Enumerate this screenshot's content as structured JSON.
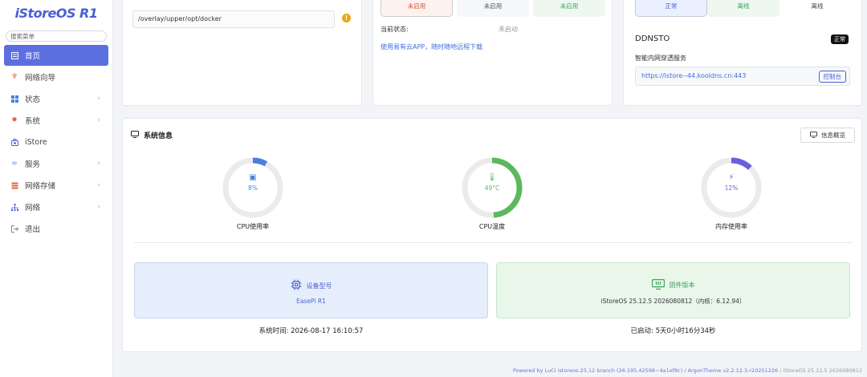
{
  "sidebar": {
    "logo": "iStoreOS R1",
    "search_placeholder": "搜索菜单",
    "items": [
      {
        "label": "首页",
        "icon": "home-icon",
        "active": true
      },
      {
        "label": "网络向导",
        "icon": "wizard-icon"
      },
      {
        "label": "状态",
        "icon": "status-icon",
        "arrow": "›"
      },
      {
        "label": "系统",
        "icon": "system-gear-icon",
        "arrow": "›"
      },
      {
        "label": "iStore",
        "icon": "store-icon"
      },
      {
        "label": "服务",
        "icon": "service-icon",
        "arrow": "›"
      },
      {
        "label": "网络存储",
        "icon": "storage-icon",
        "arrow": "›"
      },
      {
        "label": "网络",
        "icon": "network-icon",
        "arrow": "›"
      },
      {
        "label": "退出",
        "icon": "logout-icon"
      }
    ]
  },
  "docker_card": {
    "path": "/overlay/upper/opt/docker",
    "warn_glyph": "!"
  },
  "remote_card": {
    "segments": [
      "未启用",
      "未启用",
      "未启用"
    ],
    "status_label": "当前状态:",
    "status_value": "未启动",
    "link": "使用易有云APP，随时随地远程下载"
  },
  "ddnsto_card": {
    "segments": [
      "正常",
      "离线",
      "离线"
    ],
    "title": "DDNSTO",
    "badge": "正常",
    "subtitle": "智能内网穿透服务",
    "url": "https://istore--44.kooldns.cn:443",
    "console_btn": "控制台"
  },
  "system_info": {
    "title": "系统信息",
    "overview_btn": "信息概览",
    "gauges": [
      {
        "label": "CPU使用率",
        "value": "8%",
        "percent": 8,
        "color": "#4a7fe0",
        "icon": "cpu-icon",
        "glyph": "▣"
      },
      {
        "label": "CPU温度",
        "value": "49°C",
        "percent": 49,
        "color": "#5cb85c",
        "icon": "thermometer-icon",
        "glyph": "🌡"
      },
      {
        "label": "内存使用率",
        "value": "12%",
        "percent": 12,
        "color": "#6b5fe0",
        "icon": "memory-icon",
        "glyph": "⚡"
      }
    ],
    "device_model_label": "设备型号",
    "device_model": "EasePi R1",
    "firmware_label": "固件版本",
    "firmware": "iStoreOS 25.12.5 2026080812（内核：6.12.94）",
    "system_time_label": "系统时间:",
    "system_time": "2026-08-17 16:10:57",
    "uptime_label": "已启动:",
    "uptime": "5天0小时16分34秒"
  },
  "footer": {
    "text": "Powered by LuCI istoreos-25.12 branch (26.195.42598~4a1ef8c) / ArgonTheme v2.2.12.3-r20251226",
    "version": " / iStoreOS 25.12.5 2026080812"
  }
}
